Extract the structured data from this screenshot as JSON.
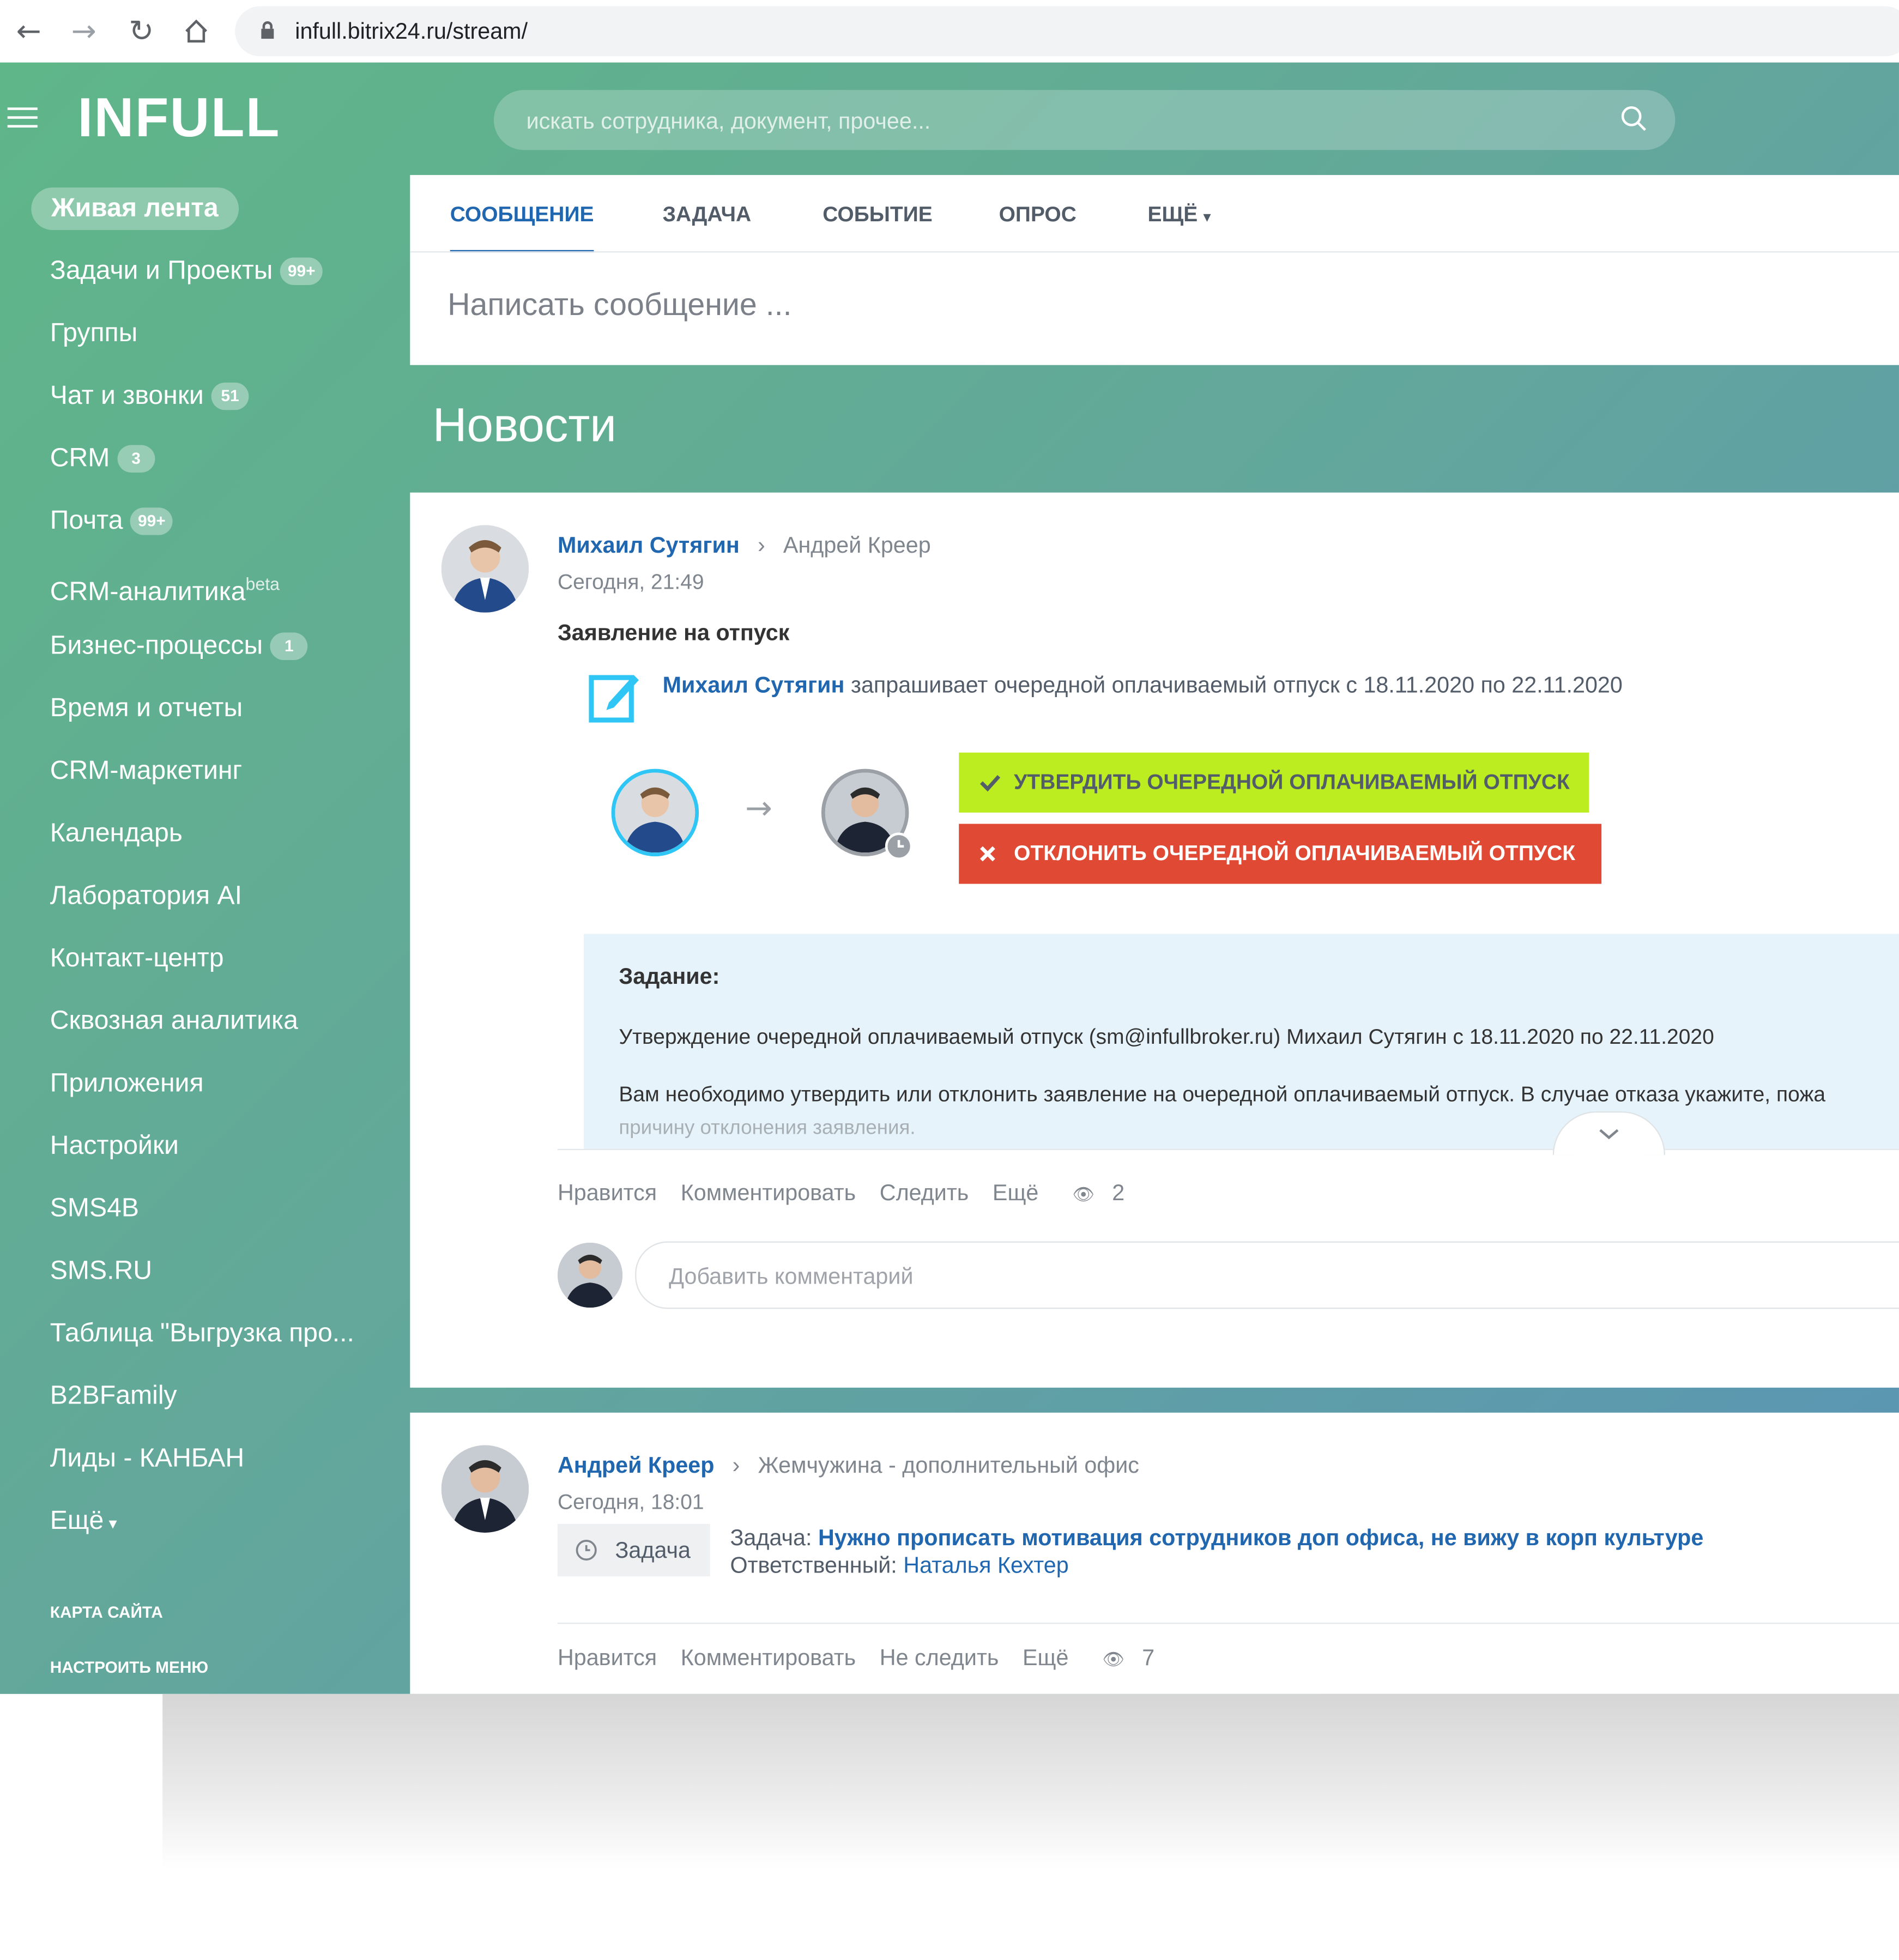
{
  "browser": {
    "url": "infull.bitrix24.ru/stream/"
  },
  "header": {
    "logo": "INFULL",
    "search_placeholder": "искать сотрудника, документ, прочее..."
  },
  "sidebar": {
    "items": [
      {
        "label": "Живая лента",
        "badge": ""
      },
      {
        "label": "Задачи и Проекты",
        "badge": "99+"
      },
      {
        "label": "Группы",
        "badge": ""
      },
      {
        "label": "Чат и звонки",
        "badge": "51"
      },
      {
        "label": "CRM",
        "badge": "3"
      },
      {
        "label": "Почта",
        "badge": "99+"
      },
      {
        "label": "CRM-аналитика",
        "badge": "",
        "sup": "beta"
      },
      {
        "label": "Бизнес-процессы",
        "badge": "1"
      },
      {
        "label": "Время и отчеты",
        "badge": ""
      },
      {
        "label": "CRM-маркетинг",
        "badge": ""
      },
      {
        "label": "Календарь",
        "badge": ""
      },
      {
        "label": "Лаборатория AI",
        "badge": ""
      },
      {
        "label": "Контакт-центр",
        "badge": ""
      },
      {
        "label": "Сквозная аналитика",
        "badge": ""
      },
      {
        "label": "Приложения",
        "badge": ""
      },
      {
        "label": "Настройки",
        "badge": ""
      },
      {
        "label": "SMS4B",
        "badge": ""
      },
      {
        "label": "SMS.RU",
        "badge": ""
      },
      {
        "label": "Таблица \"Выгрузка про...",
        "badge": ""
      },
      {
        "label": "B2BFamily",
        "badge": ""
      },
      {
        "label": "Лиды - КАНБАН",
        "badge": ""
      },
      {
        "label": "Ещё",
        "badge": ""
      }
    ],
    "sitemap": "КАРТА САЙТА",
    "configure": "НАСТРОИТЬ МЕНЮ"
  },
  "composer": {
    "tabs": [
      "СООБЩЕНИЕ",
      "ЗАДАЧА",
      "СОБЫТИЕ",
      "ОПРОС",
      "ЕЩЁ"
    ],
    "placeholder": "Написать сообщение ..."
  },
  "feed_title": "Новости",
  "post1": {
    "author": "Михаил Сутягин",
    "recipient": "Андрей Креер",
    "time": "Сегодня, 21:49",
    "title": "Заявление на отпуск",
    "request_author": "Михаил Сутягин",
    "request_text": "запрашивает очередной оплачиваемый отпуск с 18.11.2020 по 22.11.2020",
    "approve": "УТВЕРДИТЬ ОЧЕРЕДНОЙ ОПЛАЧИВАЕМЫЙ ОТПУСК",
    "decline": "ОТКЛОНИТЬ ОЧЕРЕДНОЙ ОПЛАЧИВАЕМЫЙ ОТПУСК",
    "task_label": "Задание:",
    "task_line1": "Утверждение очередной оплачиваемый отпуск (sm@infullbroker.ru) Михаил Сутягин с 18.11.2020 по 22.11.2020",
    "task_line2": "Вам необходимо утвердить или отклонить заявление на очередной оплачиваемый отпуск. В случае отказа укажите, пожа",
    "task_line3": "причину отклонения заявления.",
    "actions": [
      "Нравится",
      "Комментировать",
      "Следить",
      "Ещё"
    ],
    "views": "2",
    "comment_placeholder": "Добавить комментарий"
  },
  "post2": {
    "author": "Андрей Креер",
    "recipient": "Жемчужина - дополнительный офис",
    "time": "Сегодня, 18:01",
    "tag": "Задача",
    "task_prefix": "Задача:",
    "task_link": "Нужно прописать мотивация сотрудников доп офиса, не вижу в корп культуре",
    "resp_prefix": "Ответственный:",
    "resp_name": "Наталья Кехтер",
    "actions": [
      "Нравится",
      "Комментировать",
      "Не следить",
      "Ещё"
    ],
    "views": "7"
  },
  "colors": {
    "accent": "#2067b0",
    "approve": "#bbed21",
    "decline": "#e04a35",
    "sidebar_green": "#5fb688"
  }
}
